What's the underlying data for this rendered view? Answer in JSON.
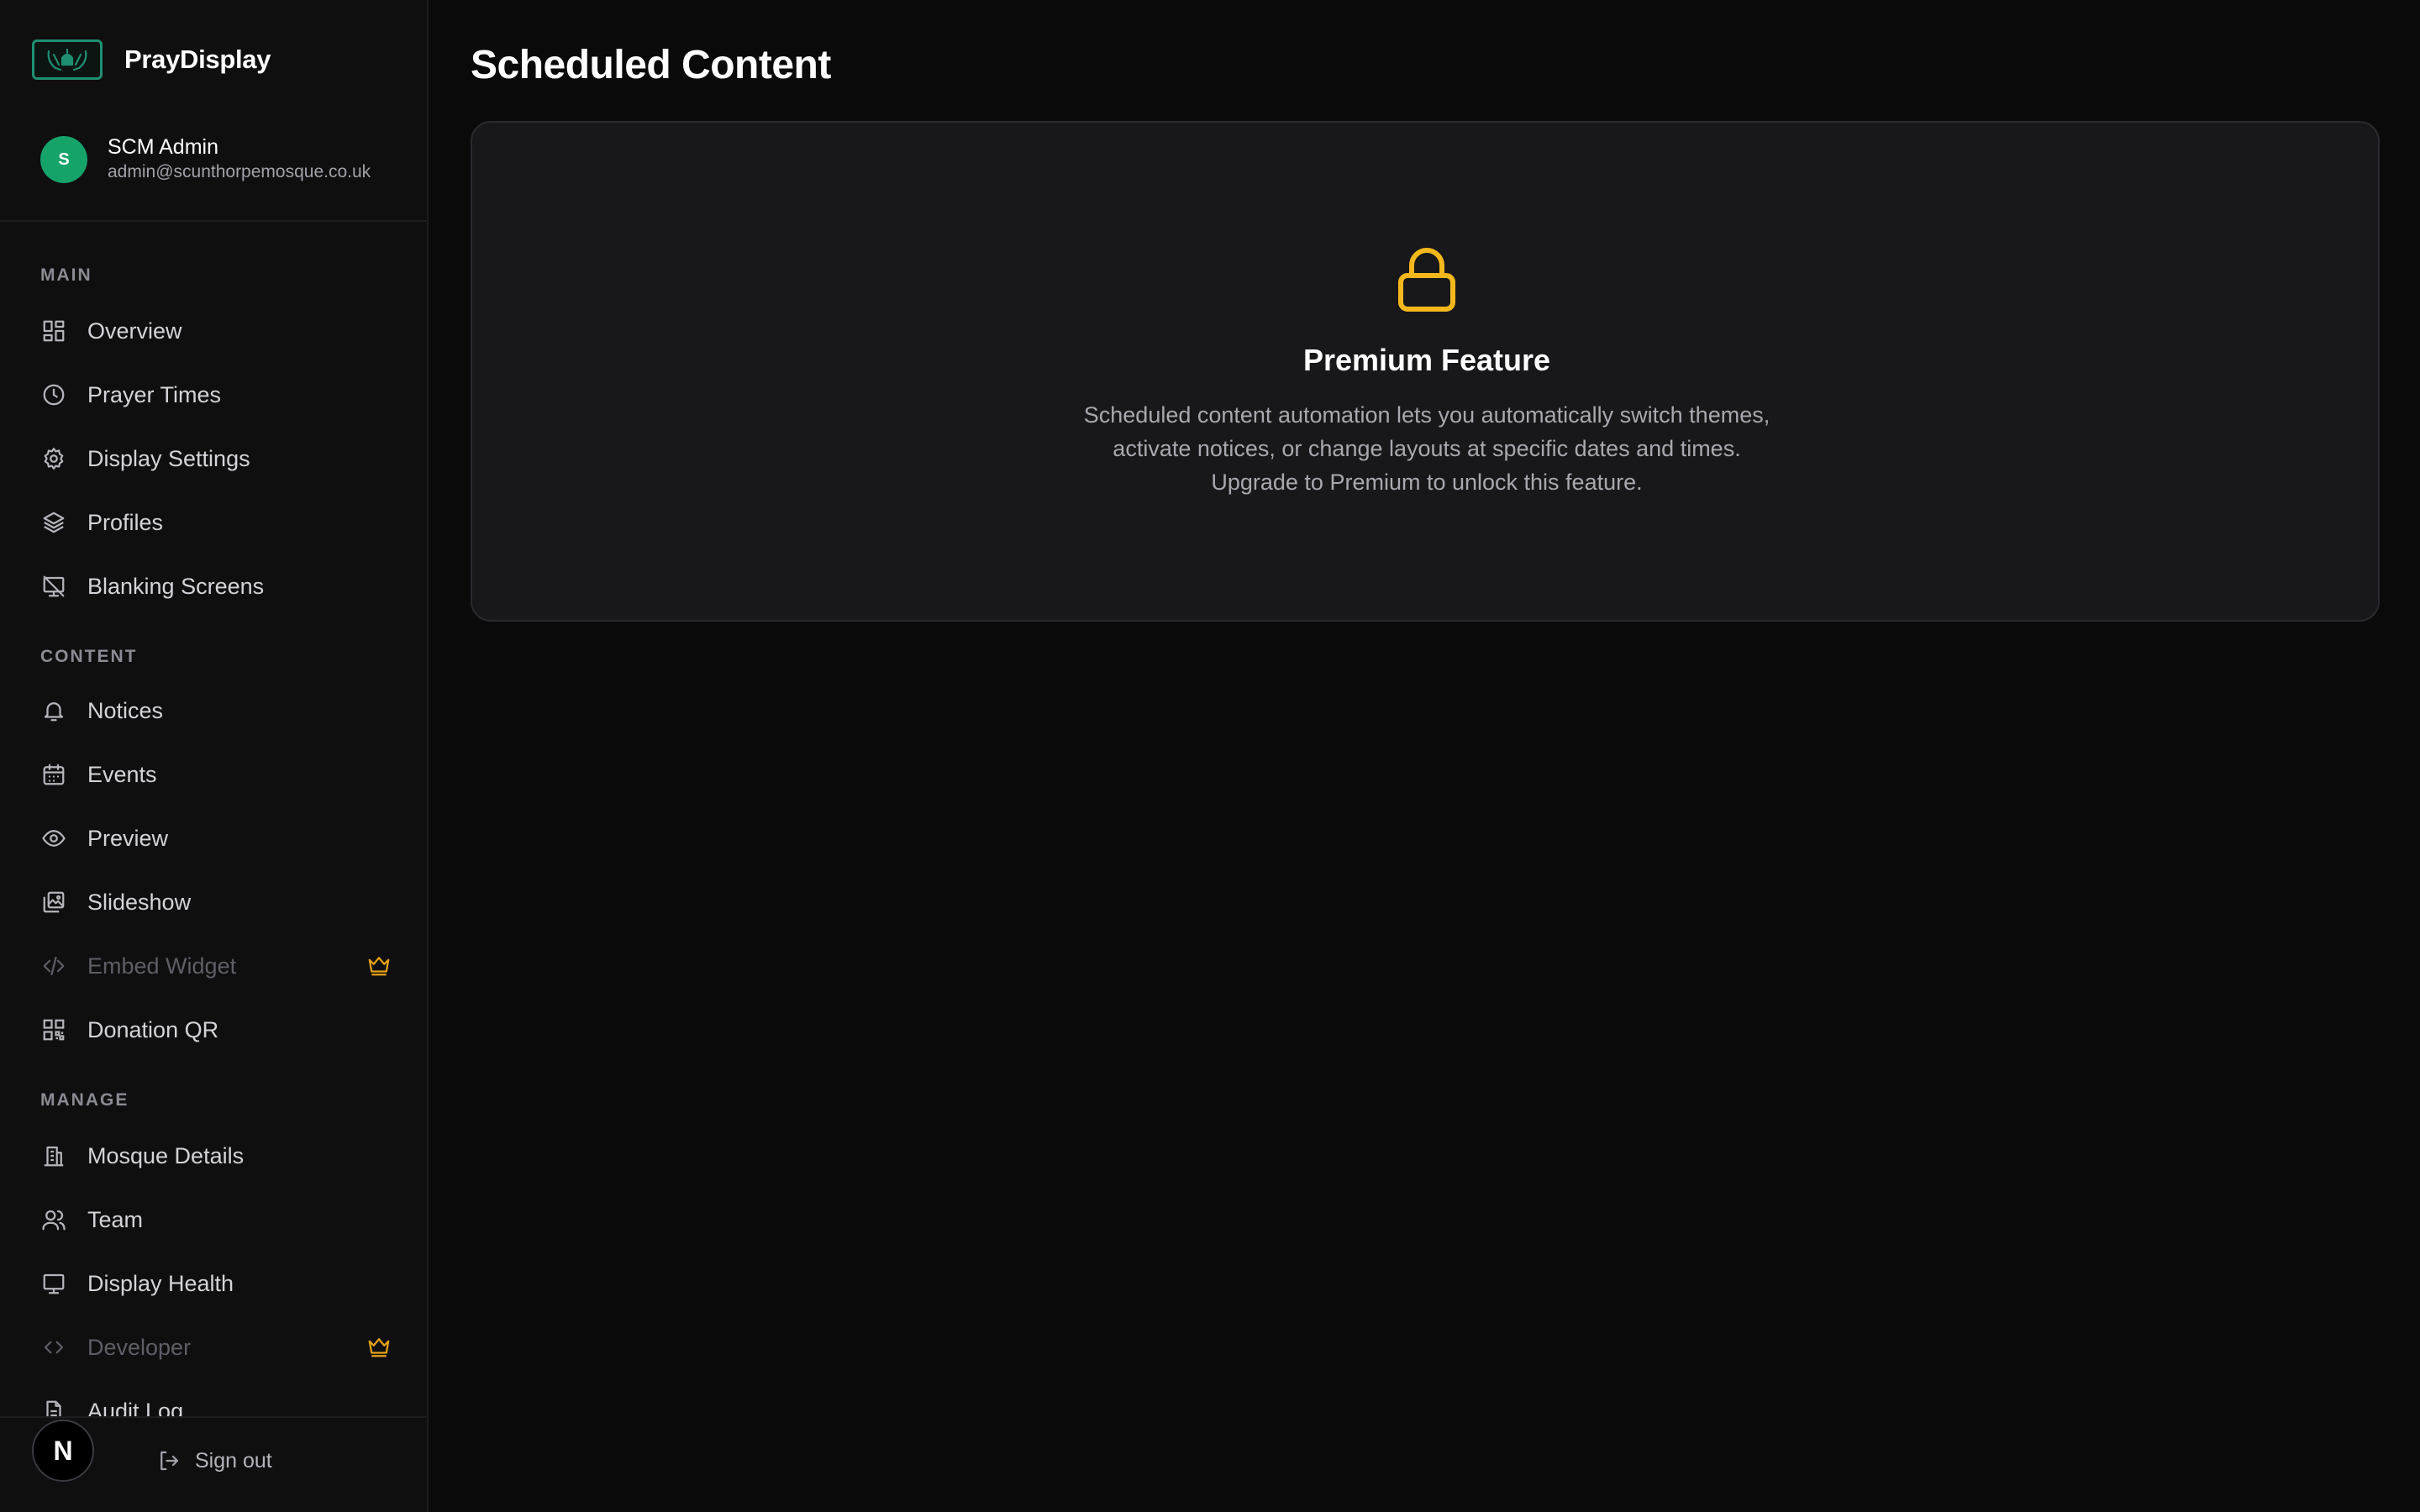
{
  "brand": {
    "name": "PrayDisplay",
    "logo_icon": "hands-mosque-icon",
    "accent": "#1f8f72"
  },
  "user": {
    "initial": "S",
    "name": "SCM Admin",
    "email": "admin@scunthorpemosque.co.uk",
    "avatar_color": "#16a36a"
  },
  "sidebar": {
    "sections": {
      "main": "MAIN",
      "content": "CONTENT",
      "manage": "MANAGE"
    },
    "items": {
      "overview": {
        "label": "Overview",
        "icon": "dashboard-grid-icon"
      },
      "prayer_times": {
        "label": "Prayer Times",
        "icon": "clock-icon"
      },
      "display_settings": {
        "label": "Display Settings",
        "icon": "gear-icon"
      },
      "profiles": {
        "label": "Profiles",
        "icon": "layers-icon"
      },
      "blanking_screens": {
        "label": "Blanking Screens",
        "icon": "monitor-off-icon"
      },
      "notices": {
        "label": "Notices",
        "icon": "bell-icon"
      },
      "events": {
        "label": "Events",
        "icon": "calendar-icon"
      },
      "preview": {
        "label": "Preview",
        "icon": "eye-icon"
      },
      "slideshow": {
        "label": "Slideshow",
        "icon": "images-icon"
      },
      "embed_widget": {
        "label": "Embed Widget",
        "icon": "code-icon",
        "premium": true
      },
      "donation_qr": {
        "label": "Donation QR",
        "icon": "qr-code-icon"
      },
      "mosque_details": {
        "label": "Mosque Details",
        "icon": "building-icon"
      },
      "team": {
        "label": "Team",
        "icon": "users-icon"
      },
      "display_health": {
        "label": "Display Health",
        "icon": "monitor-icon"
      },
      "developer": {
        "label": "Developer",
        "icon": "code-brackets-icon",
        "premium": true
      },
      "audit_log": {
        "label": "Audit Log",
        "icon": "file-text-icon"
      }
    },
    "footer": {
      "badge": "N",
      "signout_label": "Sign out"
    }
  },
  "main": {
    "title": "Scheduled Content",
    "card": {
      "icon": "lock-icon",
      "icon_color": "#f5b81c",
      "title": "Premium Feature",
      "description_lines": [
        "Scheduled content automation lets you automatically switch themes,",
        "activate notices, or change layouts at specific dates and times.",
        "Upgrade to Premium to unlock this feature."
      ]
    }
  },
  "colors": {
    "background": "#0a0a0b",
    "sidebar": "#0f0f10",
    "card": "#18181a",
    "premium": "#e6a117"
  }
}
